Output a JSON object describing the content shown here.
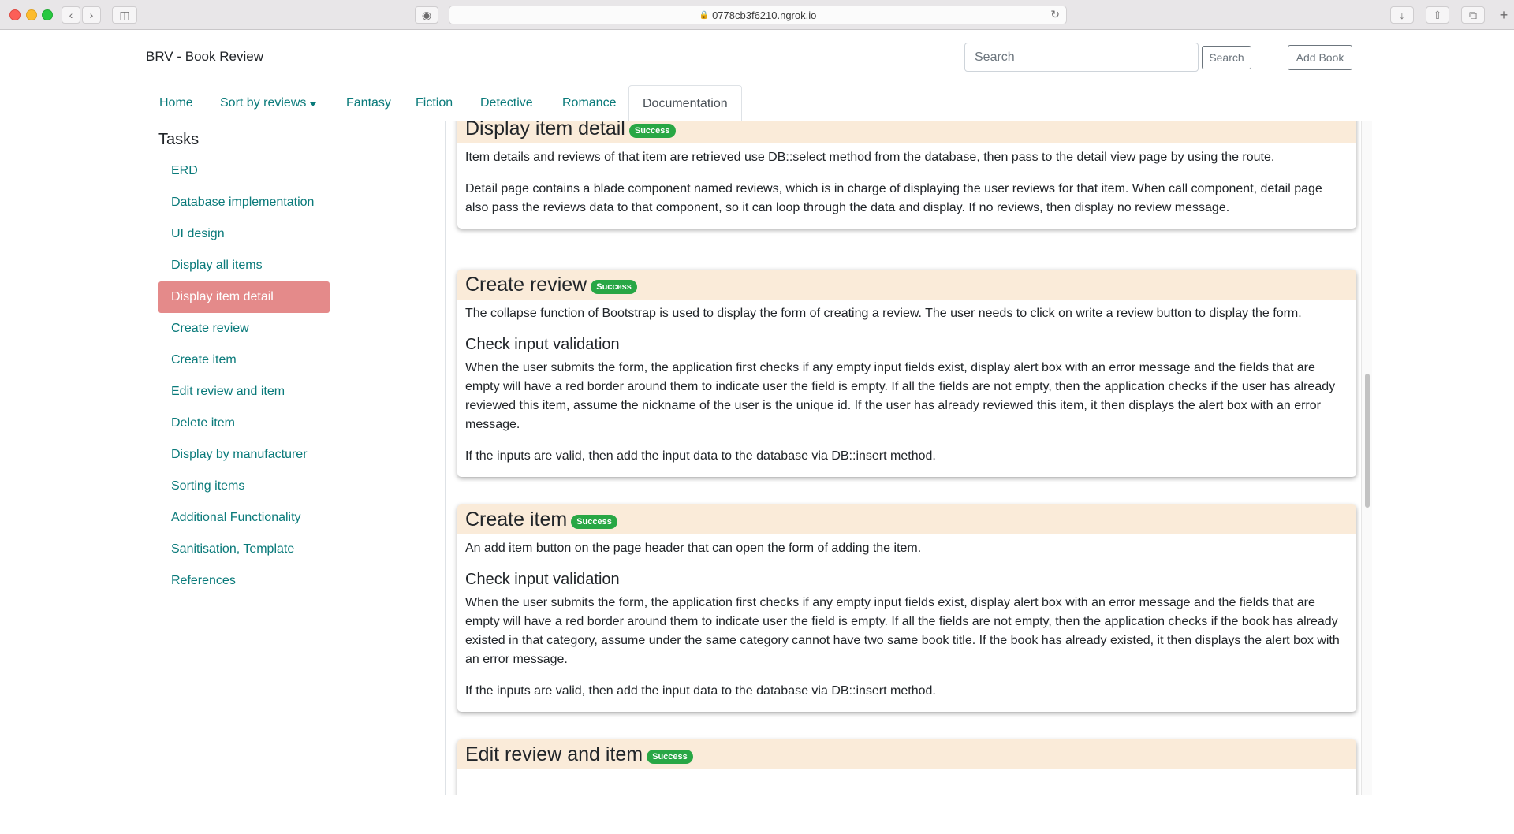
{
  "browser": {
    "url": "0778cb3f6210.ngrok.io"
  },
  "header": {
    "brand": "BRV - Book Review",
    "search_placeholder": "Search",
    "search_button": "Search",
    "add_book_button": "Add Book"
  },
  "nav": {
    "tabs": [
      {
        "label": "Home"
      },
      {
        "label": "Sort by reviews"
      },
      {
        "label": "Fantasy"
      },
      {
        "label": "Fiction"
      },
      {
        "label": "Detective"
      },
      {
        "label": "Romance"
      },
      {
        "label": "Documentation"
      }
    ],
    "active": "Documentation"
  },
  "sidebar": {
    "title": "Tasks",
    "items": [
      {
        "label": "ERD"
      },
      {
        "label": "Database implementation"
      },
      {
        "label": "UI design"
      },
      {
        "label": "Display all items"
      },
      {
        "label": "Display item detail"
      },
      {
        "label": "Create review"
      },
      {
        "label": "Create item"
      },
      {
        "label": "Edit review and item"
      },
      {
        "label": "Delete item"
      },
      {
        "label": "Display by manufacturer"
      },
      {
        "label": "Sorting items"
      },
      {
        "label": "Additional Functionality"
      },
      {
        "label": "Sanitisation, Template"
      },
      {
        "label": "References"
      }
    ],
    "active": "Display item detail",
    "active_color": "#e48a8a"
  },
  "sections": {
    "display_detail": {
      "title": "Display item detail",
      "badge": "Success",
      "p1": "Item details and reviews of that item are retrieved use DB::select method from the database, then pass to the detail view page by using the route.",
      "p2": "Detail page contains a blade component named reviews, which is in charge of displaying the user reviews for that item. When call component, detail page also pass the reviews data to that component, so it can loop through the data and display. If no reviews, then display no review message."
    },
    "create_review": {
      "title": "Create review",
      "badge": "Success",
      "p1": "The collapse function of Bootstrap is used to display the form of creating a review. The user needs to click on write a review button to display the form.",
      "subheading": "Check input validation",
      "p2": "When the user submits the form, the application first checks if any empty input fields exist, display alert box with an error message and the fields that are empty will have a red border around them to indicate user the field is empty. If all the fields are not empty, then the application checks if the user has already reviewed this item, assume the nickname of the user is the unique id. If the user has already reviewed this item, it then displays the alert box with an error message.",
      "p3": "If the inputs are valid, then add the input data to the database via DB::insert method."
    },
    "create_item": {
      "title": "Create item",
      "badge": "Success",
      "p1": "An add item button on the page header that can open the form of adding the item.",
      "subheading": "Check input validation",
      "p2": "When the user submits the form, the application first checks if any empty input fields exist, display alert box with an error message and the fields that are empty will have a red border around them to indicate user the field is empty. If all the fields are not empty, then the application checks if the book has already existed in that category, assume under the same category cannot have two same book title. If the book has already existed, it then displays the alert box with an error message.",
      "p3": "If the inputs are valid, then add the input data to the database via DB::insert method."
    },
    "edit_review": {
      "title": "Edit review and item",
      "badge": "Success"
    }
  },
  "colors": {
    "link": "#0a7a7a",
    "card_header": "#faebd9",
    "badge": "#28a745"
  }
}
